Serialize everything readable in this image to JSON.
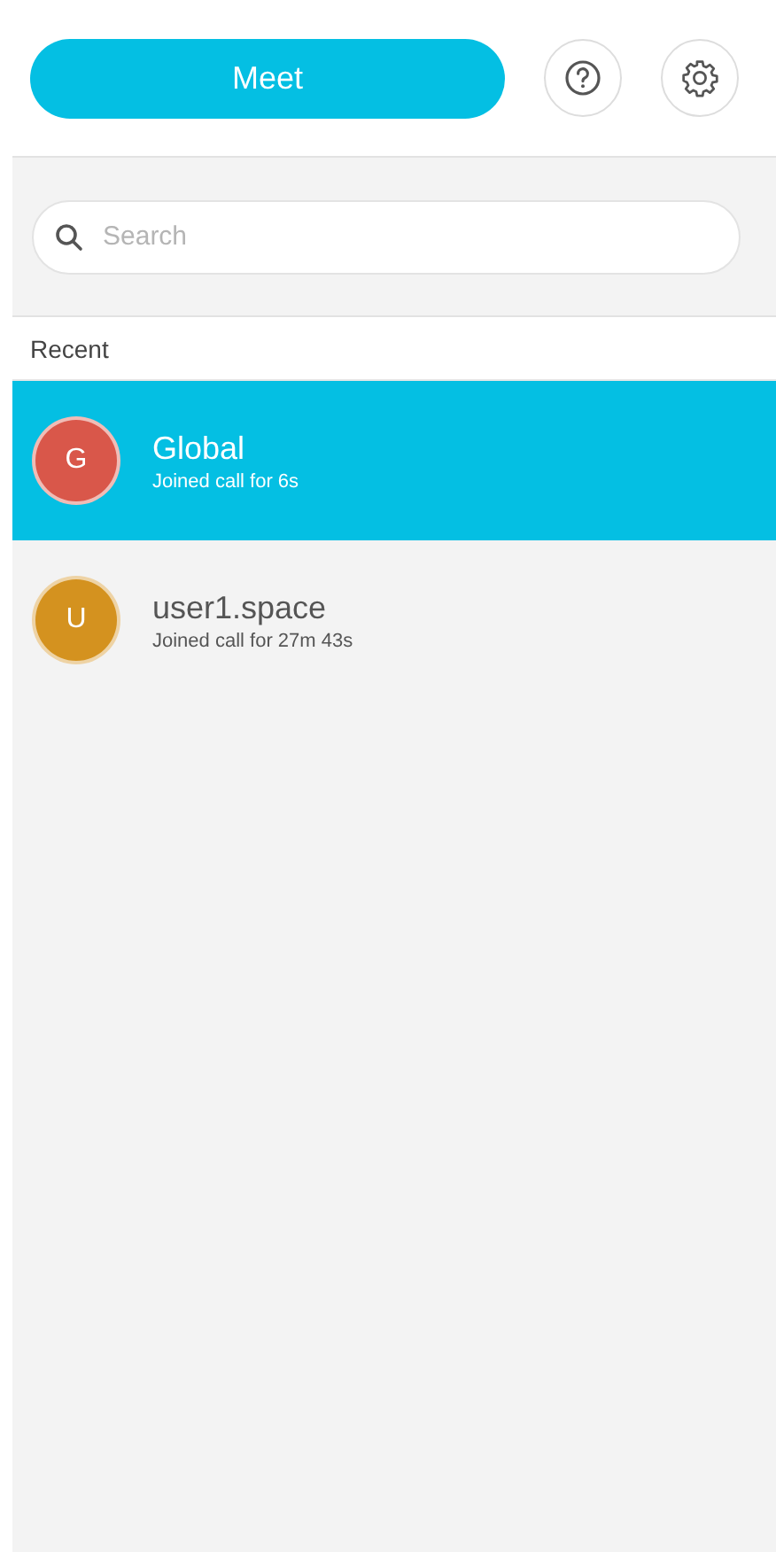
{
  "meet_button": {
    "label": "Meet"
  },
  "search": {
    "placeholder": "Search"
  },
  "section_label": "Recent",
  "calls": [
    {
      "initial": "G",
      "name": "Global",
      "status": "Joined call for 6s",
      "color": "#d9574a",
      "selected": true
    },
    {
      "initial": "U",
      "name": "user1.space",
      "status": "Joined call for 27m 43s",
      "color": "#d4921f",
      "selected": false
    }
  ]
}
